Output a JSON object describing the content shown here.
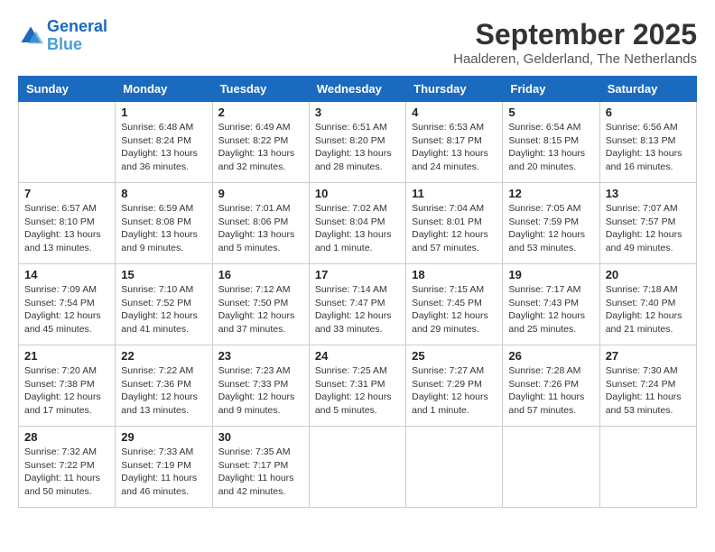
{
  "header": {
    "logo_line1": "General",
    "logo_line2": "Blue",
    "month": "September 2025",
    "location": "Haalderen, Gelderland, The Netherlands"
  },
  "weekdays": [
    "Sunday",
    "Monday",
    "Tuesday",
    "Wednesday",
    "Thursday",
    "Friday",
    "Saturday"
  ],
  "weeks": [
    [
      null,
      {
        "day": 1,
        "sunrise": "6:48 AM",
        "sunset": "8:24 PM",
        "daylight": "13 hours and 36 minutes."
      },
      {
        "day": 2,
        "sunrise": "6:49 AM",
        "sunset": "8:22 PM",
        "daylight": "13 hours and 32 minutes."
      },
      {
        "day": 3,
        "sunrise": "6:51 AM",
        "sunset": "8:20 PM",
        "daylight": "13 hours and 28 minutes."
      },
      {
        "day": 4,
        "sunrise": "6:53 AM",
        "sunset": "8:17 PM",
        "daylight": "13 hours and 24 minutes."
      },
      {
        "day": 5,
        "sunrise": "6:54 AM",
        "sunset": "8:15 PM",
        "daylight": "13 hours and 20 minutes."
      },
      {
        "day": 6,
        "sunrise": "6:56 AM",
        "sunset": "8:13 PM",
        "daylight": "13 hours and 16 minutes."
      }
    ],
    [
      {
        "day": 7,
        "sunrise": "6:57 AM",
        "sunset": "8:10 PM",
        "daylight": "13 hours and 13 minutes."
      },
      {
        "day": 8,
        "sunrise": "6:59 AM",
        "sunset": "8:08 PM",
        "daylight": "13 hours and 9 minutes."
      },
      {
        "day": 9,
        "sunrise": "7:01 AM",
        "sunset": "8:06 PM",
        "daylight": "13 hours and 5 minutes."
      },
      {
        "day": 10,
        "sunrise": "7:02 AM",
        "sunset": "8:04 PM",
        "daylight": "13 hours and 1 minute."
      },
      {
        "day": 11,
        "sunrise": "7:04 AM",
        "sunset": "8:01 PM",
        "daylight": "12 hours and 57 minutes."
      },
      {
        "day": 12,
        "sunrise": "7:05 AM",
        "sunset": "7:59 PM",
        "daylight": "12 hours and 53 minutes."
      },
      {
        "day": 13,
        "sunrise": "7:07 AM",
        "sunset": "7:57 PM",
        "daylight": "12 hours and 49 minutes."
      }
    ],
    [
      {
        "day": 14,
        "sunrise": "7:09 AM",
        "sunset": "7:54 PM",
        "daylight": "12 hours and 45 minutes."
      },
      {
        "day": 15,
        "sunrise": "7:10 AM",
        "sunset": "7:52 PM",
        "daylight": "12 hours and 41 minutes."
      },
      {
        "day": 16,
        "sunrise": "7:12 AM",
        "sunset": "7:50 PM",
        "daylight": "12 hours and 37 minutes."
      },
      {
        "day": 17,
        "sunrise": "7:14 AM",
        "sunset": "7:47 PM",
        "daylight": "12 hours and 33 minutes."
      },
      {
        "day": 18,
        "sunrise": "7:15 AM",
        "sunset": "7:45 PM",
        "daylight": "12 hours and 29 minutes."
      },
      {
        "day": 19,
        "sunrise": "7:17 AM",
        "sunset": "7:43 PM",
        "daylight": "12 hours and 25 minutes."
      },
      {
        "day": 20,
        "sunrise": "7:18 AM",
        "sunset": "7:40 PM",
        "daylight": "12 hours and 21 minutes."
      }
    ],
    [
      {
        "day": 21,
        "sunrise": "7:20 AM",
        "sunset": "7:38 PM",
        "daylight": "12 hours and 17 minutes."
      },
      {
        "day": 22,
        "sunrise": "7:22 AM",
        "sunset": "7:36 PM",
        "daylight": "12 hours and 13 minutes."
      },
      {
        "day": 23,
        "sunrise": "7:23 AM",
        "sunset": "7:33 PM",
        "daylight": "12 hours and 9 minutes."
      },
      {
        "day": 24,
        "sunrise": "7:25 AM",
        "sunset": "7:31 PM",
        "daylight": "12 hours and 5 minutes."
      },
      {
        "day": 25,
        "sunrise": "7:27 AM",
        "sunset": "7:29 PM",
        "daylight": "12 hours and 1 minute."
      },
      {
        "day": 26,
        "sunrise": "7:28 AM",
        "sunset": "7:26 PM",
        "daylight": "11 hours and 57 minutes."
      },
      {
        "day": 27,
        "sunrise": "7:30 AM",
        "sunset": "7:24 PM",
        "daylight": "11 hours and 53 minutes."
      }
    ],
    [
      {
        "day": 28,
        "sunrise": "7:32 AM",
        "sunset": "7:22 PM",
        "daylight": "11 hours and 50 minutes."
      },
      {
        "day": 29,
        "sunrise": "7:33 AM",
        "sunset": "7:19 PM",
        "daylight": "11 hours and 46 minutes."
      },
      {
        "day": 30,
        "sunrise": "7:35 AM",
        "sunset": "7:17 PM",
        "daylight": "11 hours and 42 minutes."
      },
      null,
      null,
      null,
      null
    ]
  ],
  "labels": {
    "sunrise": "Sunrise:",
    "sunset": "Sunset:",
    "daylight": "Daylight:"
  }
}
